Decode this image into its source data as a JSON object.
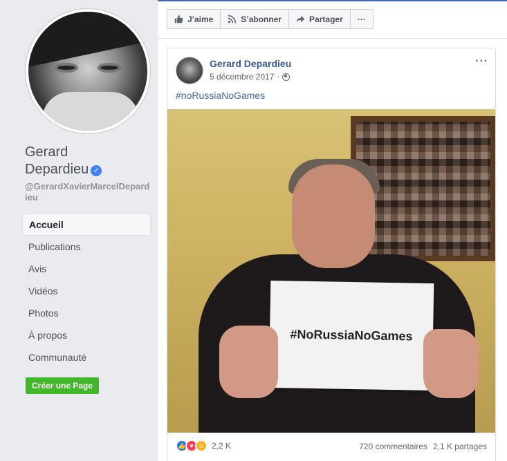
{
  "profile": {
    "name_line1": "Gerard",
    "name_line2": "Depardieu",
    "username": "@GerardXavierMarcelDepardieu",
    "verified": true
  },
  "nav": {
    "items": [
      {
        "label": "Accueil",
        "active": true
      },
      {
        "label": "Publications",
        "active": false
      },
      {
        "label": "Avis",
        "active": false
      },
      {
        "label": "Vidéos",
        "active": false
      },
      {
        "label": "Photos",
        "active": false
      },
      {
        "label": "À propos",
        "active": false
      },
      {
        "label": "Communauté",
        "active": false
      }
    ],
    "create_page": "Créer une Page"
  },
  "actions": {
    "like": "J’aime",
    "subscribe": "S’abonner",
    "share": "Partager",
    "more": "···"
  },
  "post": {
    "author": "Gerard Depardieu",
    "date": "5 décembre 2017",
    "text": "#noRussiaNoGames",
    "sign_text": "#NoRussiaNoGames",
    "more": "···",
    "reaction_count": "2,2 K",
    "comments": "720 commentaires",
    "shares": "2,1 K partages"
  },
  "colors": {
    "brand_blue": "#4267b2",
    "link_blue": "#385898",
    "green_button": "#42b72a",
    "page_bg": "#e9ebee"
  },
  "icons": {
    "like": "thumbs-up-icon",
    "subscribe": "rss-icon",
    "share": "share-arrow-icon",
    "privacy": "globe-icon",
    "verified": "check-badge-icon"
  }
}
